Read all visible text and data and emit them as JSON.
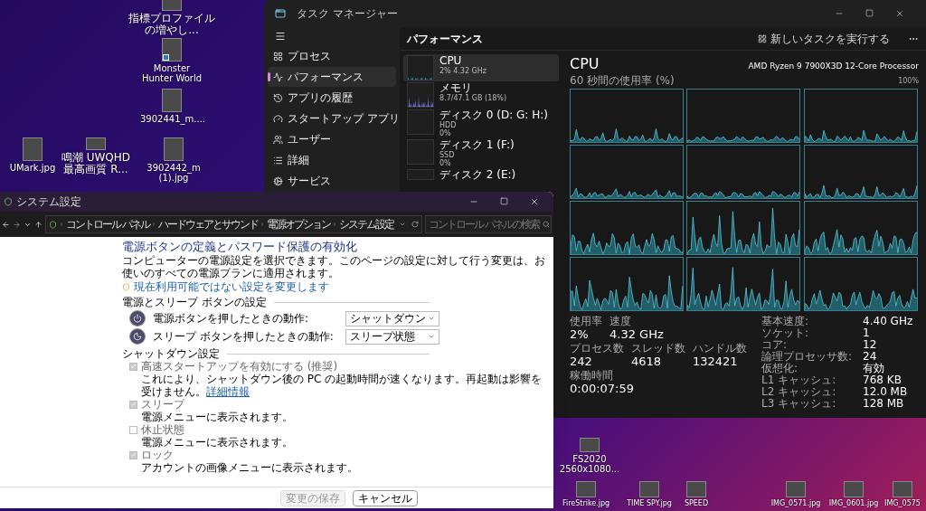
{
  "desktop_icons": [
    {
      "label": "指標プロファイルの増やし...",
      "shortcut": false
    },
    {
      "label": "Monster Hunter World",
      "shortcut": true
    },
    {
      "label": "3902441_m....",
      "shortcut": false
    },
    {
      "label": "UMark.jpg",
      "shortcut": false
    },
    {
      "label": "鳴潮 UWQHD 最高画質 R...",
      "shortcut": false
    },
    {
      "label": "3902442_m (1).jpg",
      "shortcut": false
    },
    {
      "label": "FS2020 2560x1080...",
      "shortcut": false
    },
    {
      "label": "FireStrike.jpg",
      "shortcut": false
    },
    {
      "label": "TIME SPY.jpg",
      "shortcut": false
    },
    {
      "label": "SPEED",
      "shortcut": false
    },
    {
      "label": "IMG_0571.jpg",
      "shortcut": false
    },
    {
      "label": "IMG_0601.jpg",
      "shortcut": false
    },
    {
      "label": "IMG_0575",
      "shortcut": false
    }
  ],
  "task_manager": {
    "title": "タスク マネージャー",
    "nav": [
      {
        "label": "プロセス",
        "selected": false
      },
      {
        "label": "パフォーマンス",
        "selected": true
      },
      {
        "label": "アプリの履歴",
        "selected": false
      },
      {
        "label": "スタートアップ アプリ",
        "selected": false
      },
      {
        "label": "ユーザー",
        "selected": false
      },
      {
        "label": "詳細",
        "selected": false
      },
      {
        "label": "サービス",
        "selected": false
      }
    ],
    "header": {
      "title": "パフォーマンス",
      "run_task_button": "新しいタスクを実行する"
    },
    "resources": [
      {
        "name": "CPU",
        "lines": [
          "2% 4.32 GHz"
        ],
        "selected": true
      },
      {
        "name": "メモリ",
        "lines": [
          "8.7/47.1 GB (18%)"
        ],
        "selected": false
      },
      {
        "name": "ディスク 0 (D: G: H:)",
        "lines": [
          "HDD",
          "0%"
        ],
        "selected": false
      },
      {
        "name": "ディスク 1 (F:)",
        "lines": [
          "SSD",
          "0%"
        ],
        "selected": false
      },
      {
        "name": "ディスク 2 (E:)",
        "selected": false
      }
    ],
    "detail": {
      "title": "CPU",
      "processor": "AMD Ryzen 9 7900X3D 12-Core Processor",
      "graph_label": "60 秒間の使用率 (%)",
      "graph_max": "100%",
      "stat_rows": [
        {
          "items": [
            {
              "label": "使用率",
              "value": "2%"
            },
            {
              "label": "速度",
              "value": "4.32 GHz"
            }
          ]
        },
        {
          "items": [
            {
              "label": "プロセス数",
              "value": "242"
            },
            {
              "label": "スレッド数",
              "value": "4618"
            },
            {
              "label": "ハンドル数",
              "value": "132421"
            }
          ]
        },
        {
          "items": [
            {
              "label": "稼働時間",
              "value": "0:00:07:59"
            }
          ]
        }
      ],
      "specs": [
        {
          "label": "基本速度:",
          "value": "4.40 GHz"
        },
        {
          "label": "ソケット:",
          "value": "1"
        },
        {
          "label": "コア:",
          "value": "12"
        },
        {
          "label": "論理プロセッサ数:",
          "value": "24"
        },
        {
          "label": "仮想化:",
          "value": "有効"
        },
        {
          "label": "L1 キャッシュ:",
          "value": "768 KB"
        },
        {
          "label": "L2 キャッシュ:",
          "value": "12.0 MB"
        },
        {
          "label": "L3 キャッシュ:",
          "value": "128 MB"
        }
      ]
    }
  },
  "system_settings": {
    "title": "システム設定",
    "breadcrumb": [
      "コントロール パネル",
      "ハードウェアとサウンド",
      "電源オプション",
      "システム設定"
    ],
    "search": {
      "placeholder": "コントロール パネルの検索"
    },
    "heading": "電源ボタンの定義とパスワード保護の有効化",
    "description": "コンピューターの電源設定を選択できます。このページの設定に対して行う変更は、お使いのすべての電源プランに適用されます。",
    "admin_link": "現在利用可能ではない設定を変更します",
    "power_section": {
      "title": "電源とスリープ ボタンの設定",
      "rows": [
        {
          "kind": "power",
          "label": "電源ボタンを押したときの動作:",
          "value": "シャットダウン"
        },
        {
          "kind": "sleep",
          "label": "スリープ ボタンを押したときの動作:",
          "value": "スリープ状態"
        }
      ]
    },
    "shutdown_section": {
      "title": "シャットダウン設定",
      "options": [
        {
          "label": "高速スタートアップを有効にする (推奨)",
          "description": "これにより、シャットダウン後の PC の起動時間が速くなります。再起動は影響を受けません。",
          "link": "詳細情報",
          "checked": true,
          "disabled": true
        },
        {
          "label": "スリープ",
          "description": "電源メニューに表示されます。",
          "checked": true,
          "disabled": true
        },
        {
          "label": "休止状態",
          "description": "電源メニューに表示されます。",
          "checked": false,
          "disabled": true
        },
        {
          "label": "ロック",
          "description": "アカウントの画像メニューに表示されます。",
          "checked": true,
          "disabled": true
        }
      ]
    },
    "buttons": [
      {
        "label": "変更の保存",
        "disabled": true
      },
      {
        "label": "キャンセル",
        "disabled": false
      }
    ]
  }
}
